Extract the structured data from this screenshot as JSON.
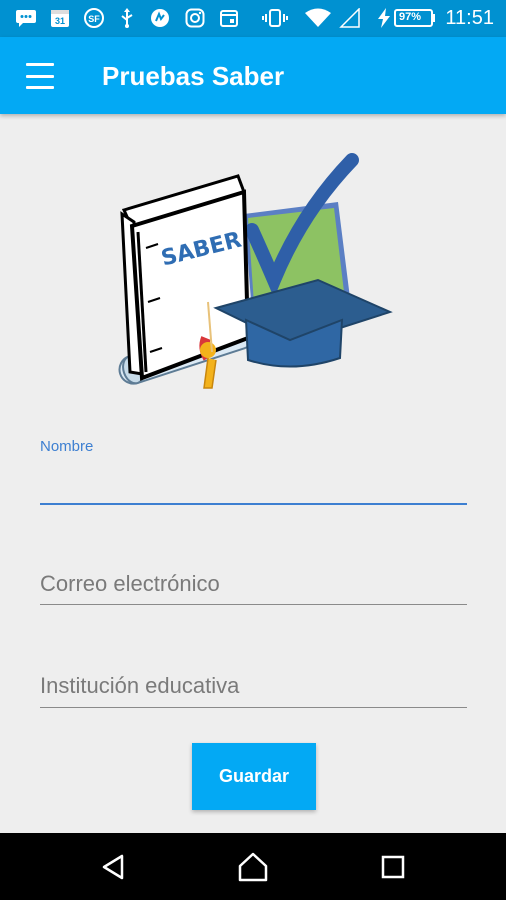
{
  "status_bar": {
    "time": "11:51",
    "battery_percent": "97%",
    "date_icon_text": "31",
    "sf_icon_text": "SF",
    "icons": [
      "message-icon",
      "calendar-icon",
      "sf-icon",
      "usb-icon",
      "app-icon",
      "instagram-icon",
      "event-icon",
      "vibrate-icon",
      "wifi-icon",
      "signal-icon",
      "charging-icon",
      "battery-icon"
    ]
  },
  "app_bar": {
    "title": "Pruebas Saber",
    "menu_icon": "hamburger-menu-icon",
    "background": "#03a9f4"
  },
  "logo": {
    "book_text": "SABER"
  },
  "form": {
    "name_label": "Nombre",
    "name_value": "",
    "email_placeholder": "Correo electrónico",
    "institution_placeholder": "Institución educativa",
    "save_label": "Guardar",
    "focused_field_color": "#3d7fd1"
  },
  "nav_bar": {
    "icons": [
      "back-icon",
      "home-icon",
      "recents-icon"
    ]
  }
}
